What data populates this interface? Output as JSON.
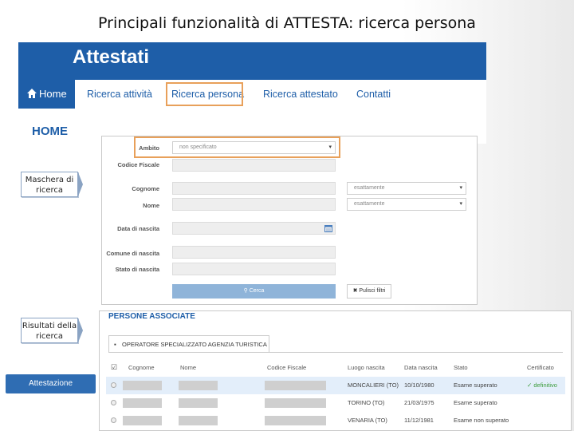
{
  "slide_title": "Principali funzionalità di ATTESTA: ricerca persona",
  "site": {
    "title": "Attestati",
    "nav": [
      "Home",
      "Ricerca attività",
      "Ricerca persona",
      "Ricerca attestato",
      "Contatti"
    ],
    "heading": "HOME"
  },
  "form": {
    "ambito_label": "Ambito",
    "ambito_value": "non specificato",
    "codice_fiscale_label": "Codice Fiscale",
    "cognome_label": "Cognome",
    "nome_label": "Nome",
    "match_option": "esattamente",
    "data_nascita_label": "Data di nascita",
    "comune_nascita_label": "Comune di nascita",
    "stato_nascita_label": "Stato di nascita",
    "cerca_label": "Cerca",
    "pulisci_label": "Pulisci filtri"
  },
  "callouts": {
    "maschera": "Maschera di ricerca",
    "risultati": "Risultati della ricerca"
  },
  "results": {
    "title": "PERSONE ASSOCIATE",
    "tab": "OPERATORE SPECIALIZZATO AGENZIA TURISTICA",
    "columns": [
      "Cognome",
      "Nome",
      "Codice Fiscale",
      "Luogo nascita",
      "Data nascita",
      "Stato",
      "Certificato"
    ],
    "rows": [
      {
        "luogo": "MONCALIERI (TO)",
        "data": "10/10/1980",
        "stato": "Esame superato",
        "certificato": "definitivo"
      },
      {
        "luogo": "TORINO (TO)",
        "data": "21/03/1975",
        "stato": "Esame superato",
        "certificato": ""
      },
      {
        "luogo": "VENARIA (TO)",
        "data": "11/12/1981",
        "stato": "Esame non superato",
        "certificato": ""
      }
    ]
  },
  "attestazione_button": "Attestazione",
  "colors": {
    "brand": "#1e5ea8",
    "highlight": "#e8a05a",
    "success": "#3a9b3a"
  }
}
